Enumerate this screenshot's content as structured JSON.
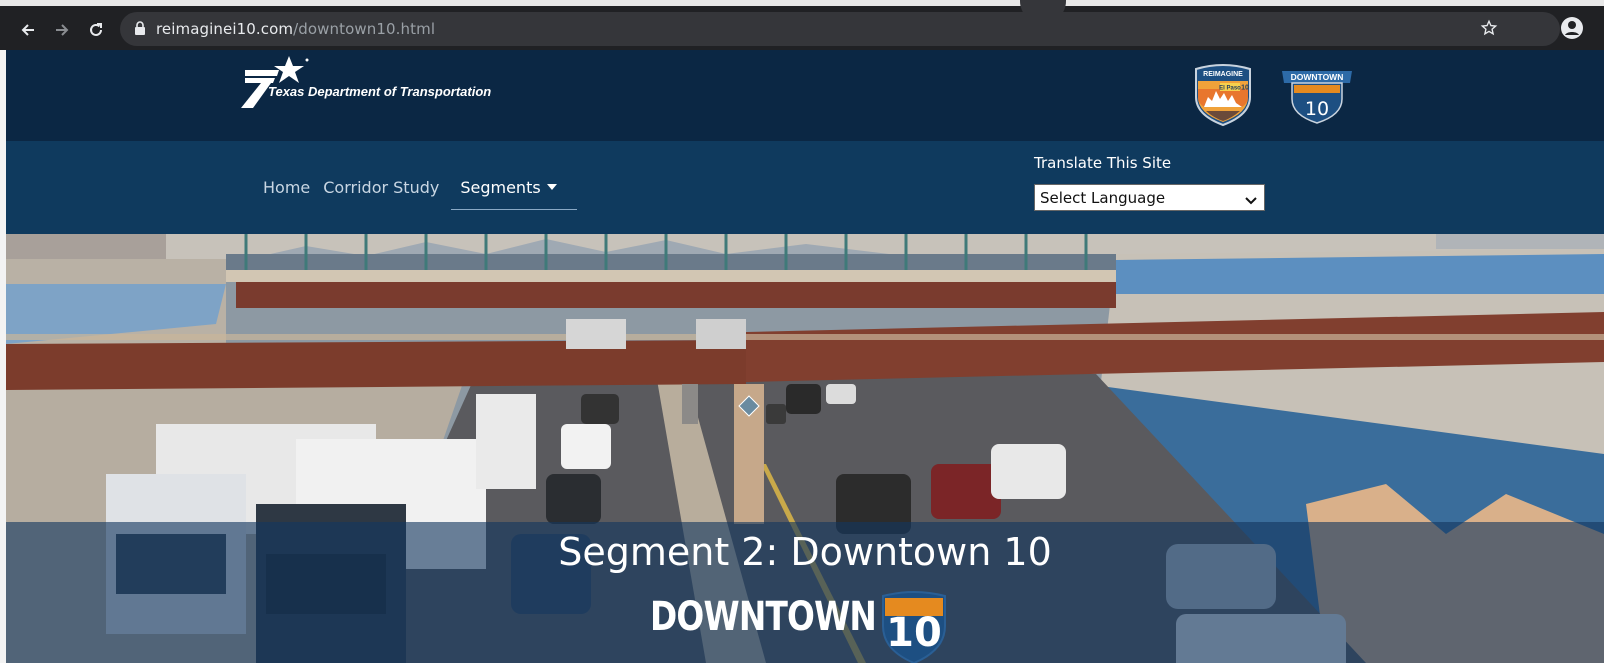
{
  "browser": {
    "url_domain": "reimaginei10.com",
    "url_path": "/downtown10.html",
    "icons": [
      "back-icon",
      "forward-icon",
      "reload-icon",
      "lock-icon",
      "star-icon",
      "profile-icon"
    ]
  },
  "header": {
    "agency_name": "Texas Department of Transportation",
    "badges": [
      {
        "name": "reimagine-el-paso-badge",
        "top_text": "REIMAGINE",
        "label": "El Paso",
        "number": "10"
      },
      {
        "name": "downtown-10-badge",
        "top_text": "DOWNTOWN",
        "number": "10"
      }
    ]
  },
  "nav": {
    "items": [
      {
        "label": "Home"
      },
      {
        "label": "Corridor Study"
      },
      {
        "label": "Segments",
        "active": true,
        "has_dropdown": true
      }
    ],
    "translate_label": "Translate This Site",
    "language_select": "Select Language"
  },
  "hero": {
    "title": "Segment 2: Downtown 10",
    "logo_word": "DOWNTOWN",
    "logo_number": "10"
  },
  "colors": {
    "header_bg": "#0b2744",
    "nav_bg": "#0f3a5e",
    "chrome_bg": "#202124",
    "bridge_rust": "#7a3b2e",
    "shield_orange": "#e58a1f"
  }
}
